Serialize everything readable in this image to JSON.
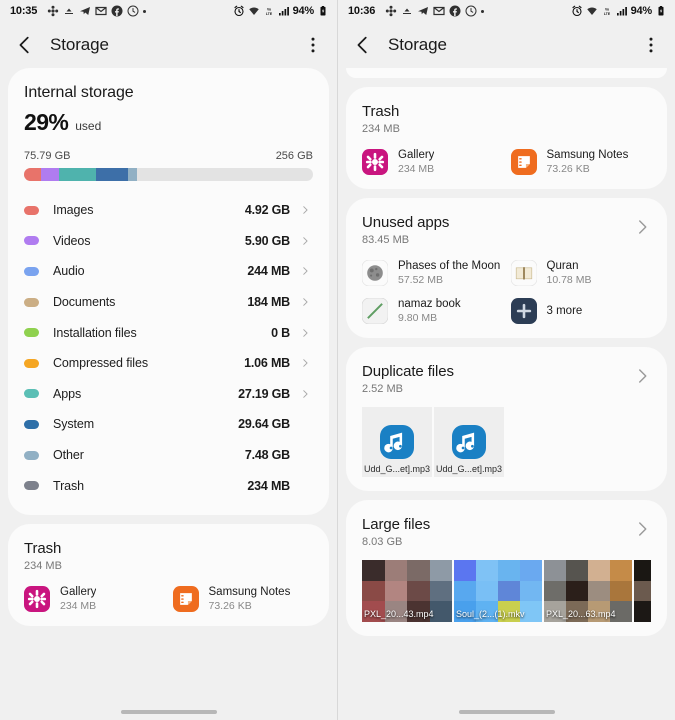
{
  "left": {
    "status": {
      "clock": "10:35",
      "battery_pct": "94%",
      "icons": [
        "flower-app-icon",
        "cloud-app-icon",
        "telegram-icon",
        "gmail-icon",
        "facebook-icon",
        "clock-circle-icon",
        "dot-indicator"
      ],
      "right_icons": [
        "alarm-icon",
        "wifi-icon",
        "volte-icon",
        "signal-icon",
        "battery-icon"
      ]
    },
    "appbar": {
      "title": "Storage",
      "back": "back-icon",
      "more": "more-options-icon"
    },
    "internal": {
      "title": "Internal storage",
      "percent": "29%",
      "used_label": "used",
      "used_size": "75.79 GB",
      "total_size": "256 GB"
    },
    "categories": [
      {
        "label": "Images",
        "size": "4.92 GB",
        "color": "#e8736a",
        "chevron": true
      },
      {
        "label": "Videos",
        "size": "5.90 GB",
        "color": "#b07cf0",
        "chevron": true
      },
      {
        "label": "Audio",
        "size": "244 MB",
        "color": "#7aa3ef",
        "chevron": true
      },
      {
        "label": "Documents",
        "size": "184 MB",
        "color": "#cbae85",
        "chevron": true
      },
      {
        "label": "Installation files",
        "size": "0 B",
        "color": "#8fd14f",
        "chevron": true
      },
      {
        "label": "Compressed files",
        "size": "1.06 MB",
        "color": "#f5a623",
        "chevron": true
      },
      {
        "label": "Apps",
        "size": "27.19 GB",
        "color": "#5bbfb5",
        "chevron": true
      },
      {
        "label": "System",
        "size": "29.64 GB",
        "color": "#2e6fa8",
        "chevron": false
      },
      {
        "label": "Other",
        "size": "7.48 GB",
        "color": "#91b0c4",
        "chevron": false
      },
      {
        "label": "Trash",
        "size": "234 MB",
        "color": "#7d818c",
        "chevron": false
      }
    ],
    "bar_segments": [
      {
        "name": "images",
        "color": "#e8736a",
        "width_pct": 6
      },
      {
        "name": "videos",
        "color": "#b07cf0",
        "width_pct": 6
      },
      {
        "name": "apps",
        "color": "#4fb3ad",
        "width_pct": 13
      },
      {
        "name": "system",
        "color": "#3d6fa8",
        "width_pct": 11
      },
      {
        "name": "other",
        "color": "#91b0c4",
        "width_pct": 3
      }
    ],
    "trash": {
      "title": "Trash",
      "subtitle": "234 MB",
      "apps": [
        {
          "name": "Gallery",
          "size": "234 MB",
          "icon": "gallery-icon"
        },
        {
          "name": "Samsung Notes",
          "size": "73.26 KB",
          "icon": "samsung-notes-icon"
        }
      ]
    }
  },
  "right": {
    "status": {
      "clock": "10:36",
      "battery_pct": "94%"
    },
    "appbar": {
      "title": "Storage",
      "back": "back-icon",
      "more": "more-options-icon"
    },
    "trash": {
      "title": "Trash",
      "subtitle": "234 MB",
      "apps": [
        {
          "name": "Gallery",
          "size": "234 MB",
          "icon": "gallery-icon"
        },
        {
          "name": "Samsung Notes",
          "size": "73.26 KB",
          "icon": "samsung-notes-icon"
        }
      ]
    },
    "unused": {
      "title": "Unused apps",
      "subtitle": "83.45 MB",
      "apps": [
        {
          "name": "Phases of the Moon",
          "size": "57.52 MB",
          "icon": "moon-app-icon"
        },
        {
          "name": "Quran",
          "size": "10.78 MB",
          "icon": "quran-book-icon"
        },
        {
          "name": "namaz book",
          "size": "9.80 MB",
          "icon": "namaz-book-icon"
        },
        {
          "name": "3 more",
          "size": "",
          "icon": "more-apps-icon"
        }
      ]
    },
    "duplicates": {
      "title": "Duplicate files",
      "subtitle": "2.52 MB",
      "files": [
        {
          "name": "Udd_G...et].mp3",
          "icon": "music-note-icon"
        },
        {
          "name": "Udd_G...et].mp3",
          "icon": "music-note-icon"
        }
      ]
    },
    "large": {
      "title": "Large files",
      "subtitle": "8.03 GB",
      "files": [
        {
          "name": "PXL_20...43.mp4"
        },
        {
          "name": "Soul_(2...(1).mkv"
        },
        {
          "name": "PXL_20...63.mp4"
        },
        {
          "name": ""
        }
      ]
    }
  }
}
